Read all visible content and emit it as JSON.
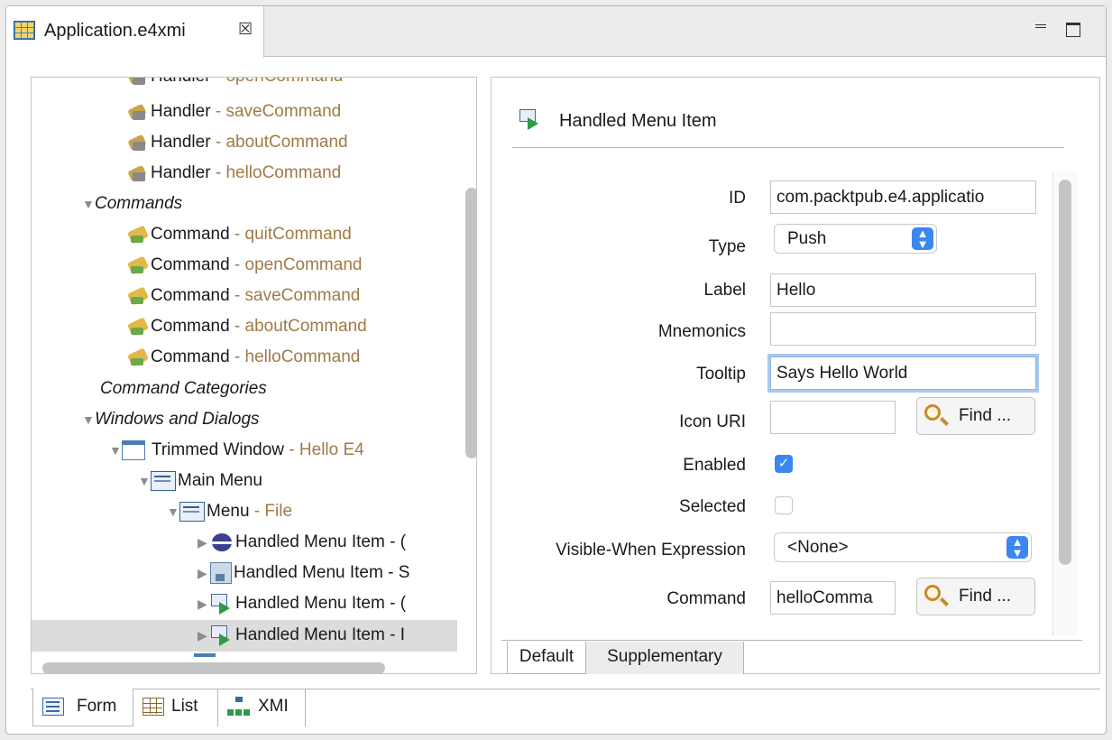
{
  "editor_tab": {
    "title": "Application.e4xmi",
    "close_glyph": "☒",
    "icon": "e4xmi-file-icon"
  },
  "window_controls": {
    "minimize": "minimize-icon",
    "maximize": "maximize-icon"
  },
  "tree": {
    "clipped_top_row": {
      "label": "Handler",
      "value": "openCommand"
    },
    "handlers": [
      {
        "label": "Handler",
        "sep": " - ",
        "value": "saveCommand"
      },
      {
        "label": "Handler",
        "sep": " - ",
        "value": "aboutCommand"
      },
      {
        "label": "Handler",
        "sep": " - ",
        "value": "helloCommand"
      }
    ],
    "commands_header": "Commands",
    "commands": [
      {
        "label": "Command",
        "sep": " - ",
        "value": "quitCommand"
      },
      {
        "label": "Command",
        "sep": " - ",
        "value": "openCommand"
      },
      {
        "label": "Command",
        "sep": " - ",
        "value": "saveCommand"
      },
      {
        "label": "Command",
        "sep": " - ",
        "value": "aboutCommand"
      },
      {
        "label": "Command",
        "sep": " - ",
        "value": "helloCommand"
      }
    ],
    "command_categories": "Command Categories",
    "windows_header": "Windows and Dialogs",
    "trimmed_window": {
      "label": "Trimmed Window",
      "sep": " - ",
      "value": "Hello E4"
    },
    "main_menu": {
      "label": "Main Menu"
    },
    "menu_file": {
      "label": "Menu",
      "sep": " - ",
      "value": "File"
    },
    "menu_items": [
      {
        "label": "Handled Menu Item - (",
        "icon": "globe-icon"
      },
      {
        "label": "Handled Menu Item - S",
        "icon": "save-icon"
      },
      {
        "label": "Handled Menu Item - (",
        "icon": "handled-menu-item-icon"
      },
      {
        "label": "Handled Menu Item - I",
        "icon": "handled-menu-item-icon",
        "selected": true
      }
    ]
  },
  "details": {
    "title": "Handled Menu Item",
    "fields": {
      "id_label": "ID",
      "id_value": "com.packtpub.e4.applicatio",
      "type_label": "Type",
      "type_value": "Push",
      "label_label": "Label",
      "label_value": "Hello",
      "mnemonics_label": "Mnemonics",
      "mnemonics_value": "",
      "tooltip_label": "Tooltip",
      "tooltip_value": "Says Hello World",
      "icon_uri_label": "Icon URI",
      "icon_uri_value": "",
      "enabled_label": "Enabled",
      "enabled_checked": true,
      "selected_label": "Selected",
      "selected_checked": false,
      "visible_when_label": "Visible-When Expression",
      "visible_when_value": "<None>",
      "command_label": "Command",
      "command_value": "helloComma"
    },
    "find_button_label": "Find ...",
    "check_glyph": "✓",
    "select_arrows": "⌃⌄",
    "inner_tabs": [
      "Default",
      "Supplementary"
    ]
  },
  "bottom_tabs": [
    "Form",
    "List",
    "XMI"
  ]
}
